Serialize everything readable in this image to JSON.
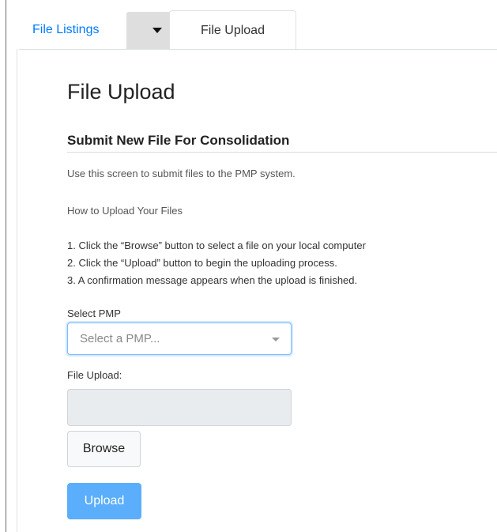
{
  "tabs": {
    "listings_label": "File Listings",
    "dropdown_icon": "caret-down-icon",
    "upload_label": "File Upload"
  },
  "page": {
    "title": "File Upload",
    "section_title": "Submit New File For Consolidation",
    "intro": "Use this screen to submit files to the PMP system.",
    "howto": "How to Upload Your Files",
    "steps": [
      "1. Click the “Browse” button to select a file on your local computer",
      "2. Click the “Upload” button to begin the uploading process.",
      "3. A confirmation message appears when the upload is finished."
    ]
  },
  "form": {
    "pmp_label": "Select PMP",
    "pmp_placeholder": "Select a PMP...",
    "file_label": "File Upload:",
    "file_value": "",
    "browse_label": "Browse",
    "upload_label": "Upload"
  },
  "colors": {
    "link": "#007bff",
    "upload_button": "#5aaefb"
  }
}
